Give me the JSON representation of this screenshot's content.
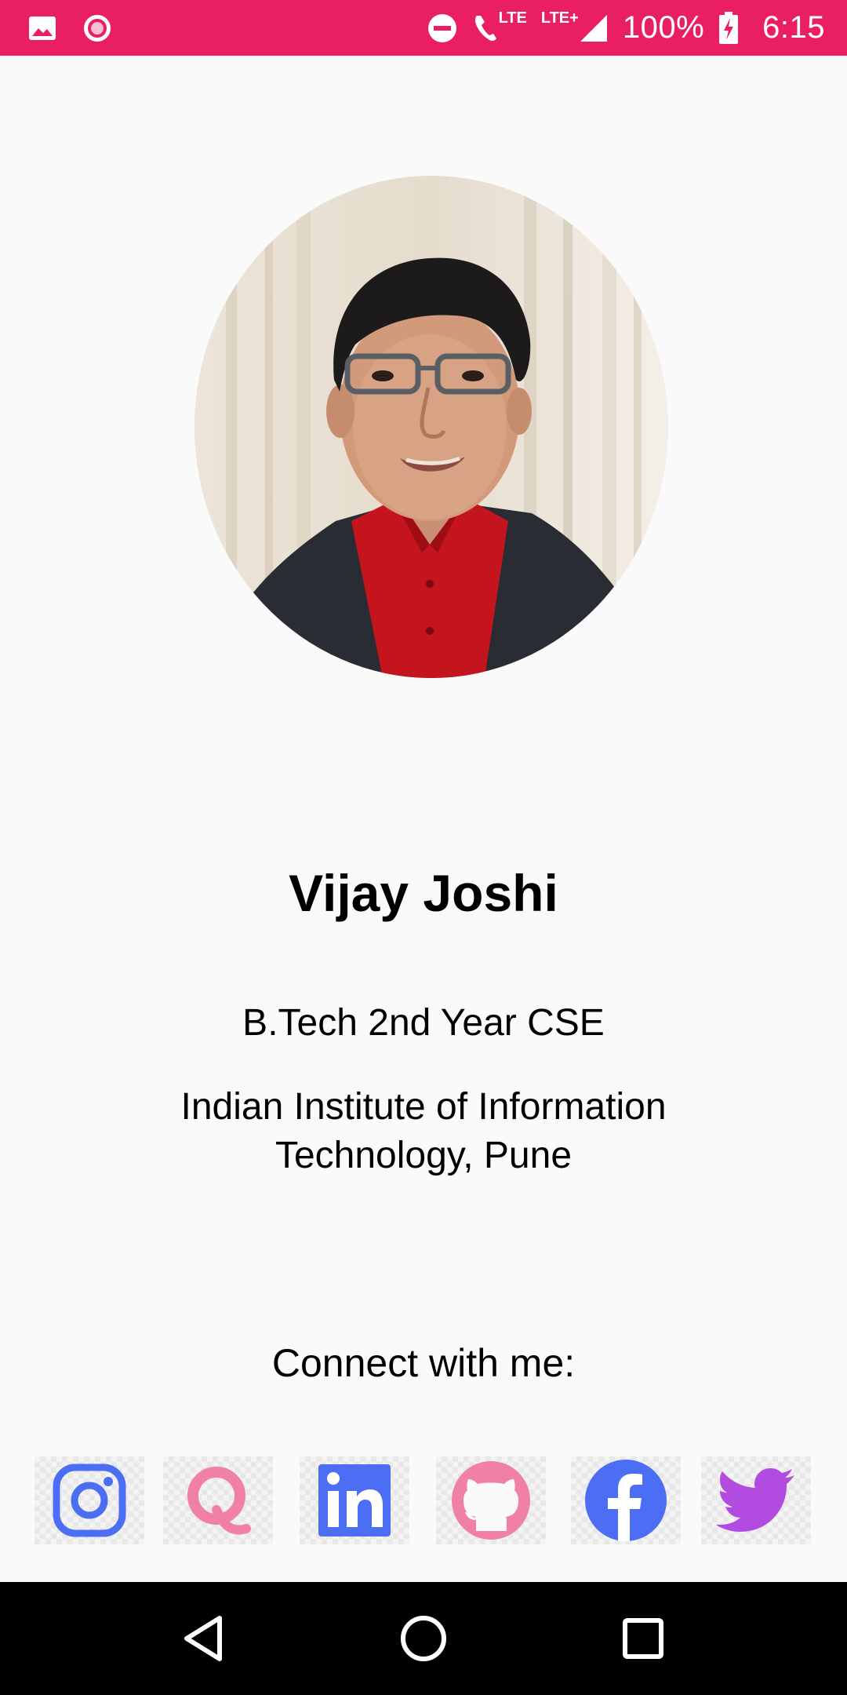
{
  "status_bar": {
    "lte1": "LTE",
    "lte2": "LTE+",
    "battery": "100%",
    "time": "6:15",
    "background_color": "#e91e63"
  },
  "profile": {
    "name": "Vijay Joshi",
    "degree": "B.Tech 2nd Year CSE",
    "institute_line1": "Indian Institute of Information",
    "institute_line2": "Technology, Pune"
  },
  "connect_label": "Connect with me:",
  "social_links": [
    {
      "icon": "instagram-icon",
      "color": "#4b6ef5"
    },
    {
      "icon": "quora-icon",
      "color": "#f080a8"
    },
    {
      "icon": "linkedin-icon",
      "color": "#4b6ef5"
    },
    {
      "icon": "github-icon",
      "color": "#f080a8"
    },
    {
      "icon": "facebook-icon",
      "color": "#4b6ef5"
    },
    {
      "icon": "twitter-icon",
      "color": "#b24be0"
    }
  ],
  "nav_bar": {
    "icons": [
      "back-icon",
      "home-icon",
      "recents-icon"
    ]
  }
}
